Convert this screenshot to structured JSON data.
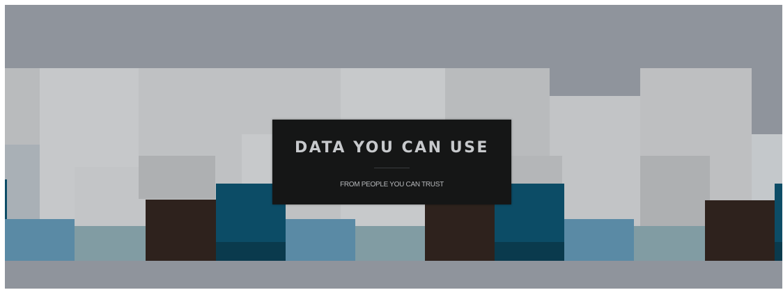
{
  "hero": {
    "headline": "DATA YOU CAN USE",
    "tagline": "FROM PEOPLE YOU CAN TRUST"
  },
  "colors": {
    "band": "#8f949c",
    "overlay": "#151616",
    "navy": "#0c4c66",
    "navy_dark": "#0a3a4d",
    "steel": "#5a8aa5",
    "sage": "#819ca3",
    "brown": "#2e221d",
    "gray_light": "#c4c6c8",
    "gray_mid": "#b7b8b9"
  }
}
